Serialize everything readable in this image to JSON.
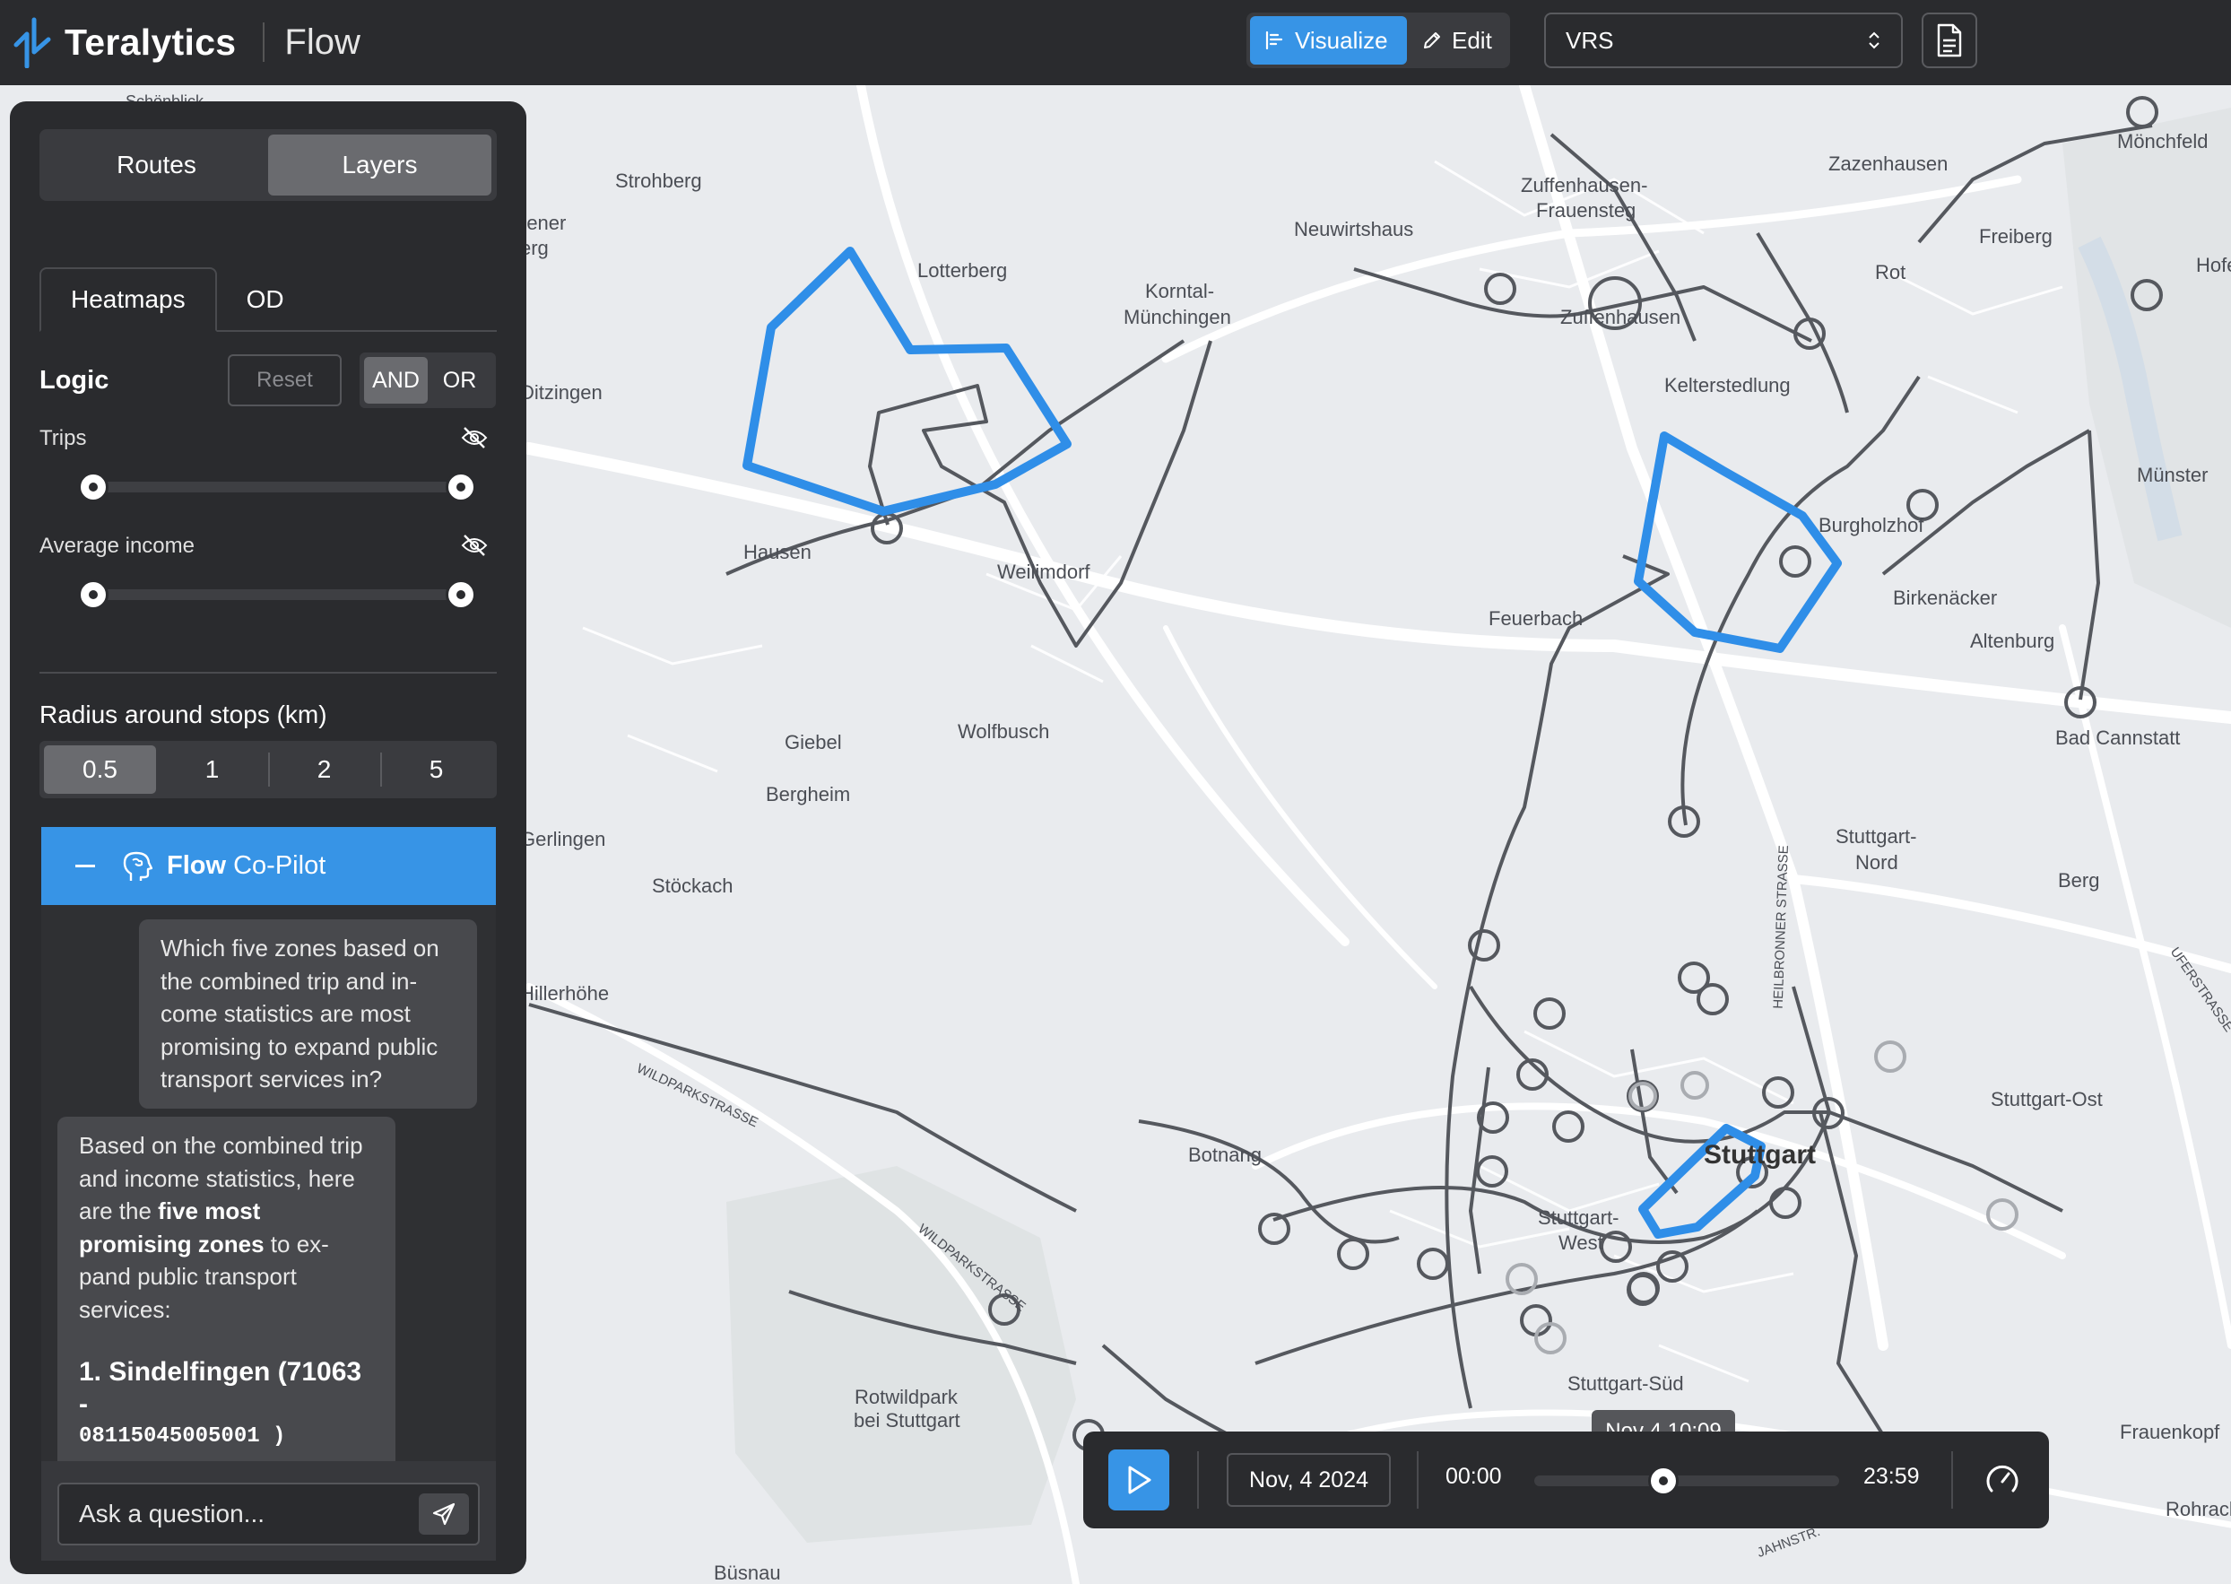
{
  "header": {
    "brand": "Teralytics",
    "app": "Flow",
    "modes": [
      {
        "label": "Visualize",
        "active": true
      },
      {
        "label": "Edit",
        "active": false
      }
    ],
    "region": "VRS",
    "icons": {
      "logo": "teralytics-logo",
      "visualize": "chart-icon",
      "edit": "pencil-icon",
      "select": "chevron-updown-icon",
      "report": "document-icon"
    }
  },
  "panel": {
    "top_tabs": [
      {
        "label": "Routes",
        "active": false
      },
      {
        "label": "Layers",
        "active": true
      }
    ],
    "sub_tabs": [
      {
        "label": "Heatmaps",
        "active": true
      },
      {
        "label": "OD",
        "active": false
      }
    ],
    "logic": {
      "label": "Logic",
      "reset": "Reset",
      "options": [
        "AND",
        "OR"
      ],
      "selected": "AND"
    },
    "sliders": [
      {
        "label": "Trips",
        "range": [
          0,
          1
        ],
        "icon": "eye-off-icon"
      },
      {
        "label": "Average income",
        "range": [
          0,
          1
        ],
        "icon": "eye-off-icon"
      }
    ],
    "radius": {
      "label": "Radius around stops (km)",
      "options": [
        "0.5",
        "1",
        "2",
        "5"
      ],
      "selected": "0.5"
    }
  },
  "copilot": {
    "title_bold": "Flow",
    "title_rest": "Co-Pilot",
    "icon": "brain-head-icon",
    "user_message": "Which five zones based on the combined trip and in-come statistics are most promising to expand public transport services in?",
    "bot_message": {
      "part1": "Based on the combined trip and income statistics, here are the ",
      "bold": "five most promising zones",
      "part2": " to ex-pand public transport services:",
      "list_item": "1. Sindelfingen (71063 -",
      "list_item_cut": "08115045005001 )"
    },
    "input_placeholder": "Ask a question..."
  },
  "timeline": {
    "date": "Nov, 4 2024",
    "start": "00:00",
    "end": "23:59",
    "tooltip": "Nov 4,10:09",
    "position": 0.423
  },
  "map": {
    "colors": {
      "zone": "#2f8ee8",
      "route": "#55585e",
      "road": "#ffffff",
      "bg": "#e9ebee"
    },
    "labels": [
      "Strohberg",
      "Lotterberg",
      "Korntal-",
      "Münchingen",
      "Neuwirtshaus",
      "Zuffenhausen-",
      "Frauensteg",
      "Zuffenhausen",
      "Zazenhausen",
      "Mönchfeld",
      "Rot",
      "Freiberg",
      "Hofen",
      "Kelterstedlung",
      "Münster",
      "Burgholzhof",
      "Birkenäcker",
      "Altenburg",
      "Bad Cannstatt",
      "Feuerbach",
      "Weilimdorf",
      "Hausen",
      "Giebel",
      "Bergheim",
      "Wolfbusch",
      "Stöckach",
      "Stuttgart-",
      "Nord",
      "Berg",
      "Stuttgart-Ost",
      "Stuttgart",
      "Botnang",
      "Stuttgart-",
      "West",
      "Stuttgart-Süd",
      "Rotwildpark",
      "bei Stuttgart",
      "Frauenkopf",
      "Rohracker",
      "Ditzingen",
      "Gerlingen",
      "Hillerhöhe",
      "Schönblick",
      "rener",
      "erg",
      "Büsnau",
      "WILDPARKSTRASSE",
      "WILDPARKSTRASSE",
      "HEILBRONNER STRASSE",
      "UFERSTRASSE",
      "JAHNSTR."
    ]
  }
}
